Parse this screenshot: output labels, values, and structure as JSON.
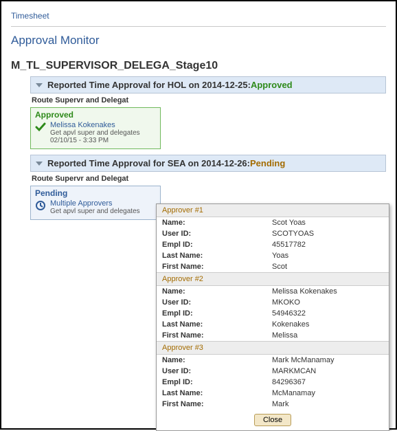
{
  "breadcrumb": "Timesheet",
  "pageTitle": "Approval Monitor",
  "stageHeading": "M_TL_SUPERVISOR_DELEGA_Stage10",
  "sections": [
    {
      "titlePrefix": "Reported Time Approval for HOL on 2014-12-25:",
      "statusText": "Approved",
      "statusKey": "approved",
      "routeLabel": "Route Supervr and Delegat",
      "routeBox": {
        "status": "Approved",
        "link": "Melissa Kokenakes",
        "sub1": "Get apvl super and delegates",
        "sub2": "02/10/15 - 3:33 PM"
      }
    },
    {
      "titlePrefix": "Reported Time Approval for SEA on 2014-12-26:",
      "statusText": "Pending",
      "statusKey": "pending",
      "routeLabel": "Route Supervr and Delegat",
      "routeBox": {
        "status": "Pending",
        "link": "Multiple Approvers",
        "sub1": "Get apvl super and delegates",
        "sub2": ""
      }
    }
  ],
  "popup": {
    "fields": {
      "name": "Name:",
      "userId": "User ID:",
      "emplId": "Empl ID:",
      "lastName": "Last Name:",
      "firstName": "First Name:"
    },
    "groups": [
      {
        "header": "Approver #1",
        "name": "Scot Yoas",
        "userId": "SCOTYOAS",
        "emplId": "45517782",
        "lastName": "Yoas",
        "firstName": "Scot"
      },
      {
        "header": "Approver #2",
        "name": "Melissa Kokenakes",
        "userId": "MKOKO",
        "emplId": "54946322",
        "lastName": "Kokenakes",
        "firstName": "Melissa"
      },
      {
        "header": "Approver #3",
        "name": "Mark McManamay",
        "userId": "MARKMCAN",
        "emplId": "84296367",
        "lastName": "McManamay",
        "firstName": "Mark"
      }
    ],
    "closeLabel": "Close"
  }
}
